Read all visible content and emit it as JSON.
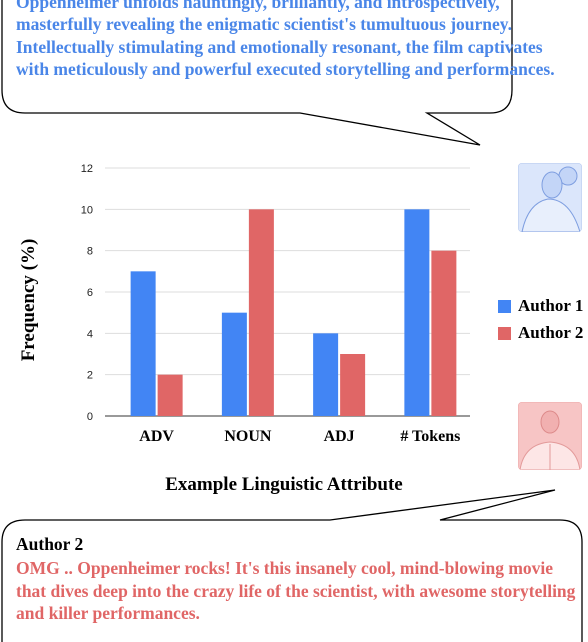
{
  "top_bubble": {
    "text": "Oppenheimer unfolds hauntingly, brilliantly, and introspectively, masterfully revealing the enigmatic scientist's tumultuous journey. Intellectually stimulating and emotionally resonant, the film captivates with meticulously and powerful executed storytelling and performances."
  },
  "bottom_bubble": {
    "author": "Author 2",
    "text": "OMG .. Oppenheimer rocks! It's this insanely cool, mind-blowing movie that dives deep into the crazy life of the scientist, with awesome storytelling and killer performances."
  },
  "avatars": {
    "author1": "woman-avatar-icon",
    "author2": "man-avatar-icon"
  },
  "chart_data": {
    "type": "bar",
    "categories": [
      "ADV",
      "NOUN",
      "ADJ",
      "# Tokens"
    ],
    "series": [
      {
        "name": "Author 1",
        "values": [
          7,
          5,
          4,
          10
        ],
        "color": "#4285f4"
      },
      {
        "name": "Author 2",
        "values": [
          2,
          10,
          3,
          8
        ],
        "color": "#e06666"
      }
    ],
    "xlabel": "Example Linguistic Attribute",
    "ylabel": "Frequency (%)",
    "ylim": [
      0,
      12
    ],
    "yticks": [
      "0",
      "2",
      "4",
      "6",
      "8",
      "10",
      "12"
    ],
    "grid": true,
    "legend": "right"
  }
}
